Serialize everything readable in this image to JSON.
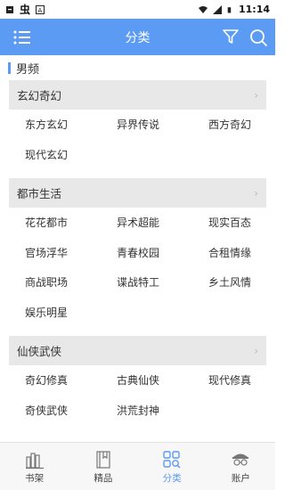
{
  "statusbar": {
    "time": "11:14"
  },
  "appbar": {
    "title": "分类"
  },
  "section": {
    "label": "男频"
  },
  "groups": [
    {
      "title": "玄幻奇幻",
      "items": [
        "东方玄幻",
        "异界传说",
        "西方奇幻",
        "现代玄幻"
      ]
    },
    {
      "title": "都市生活",
      "items": [
        "花花都市",
        "异术超能",
        "现实百态",
        "官场浮华",
        "青春校园",
        "合租情缘",
        "商战职场",
        "谍战特工",
        "乡土风情",
        "娱乐明星"
      ]
    },
    {
      "title": "仙侠武侠",
      "items": [
        "奇幻修真",
        "古典仙侠",
        "现代修真",
        "奇侠武侠",
        "洪荒封神"
      ]
    }
  ],
  "tabs": [
    {
      "label": "书架",
      "icon": "bookshelf-icon"
    },
    {
      "label": "精品",
      "icon": "book-icon"
    },
    {
      "label": "分类",
      "icon": "category-icon",
      "active": true
    },
    {
      "label": "账户",
      "icon": "account-icon"
    }
  ],
  "colors": {
    "accent": "#5b9bf3"
  }
}
